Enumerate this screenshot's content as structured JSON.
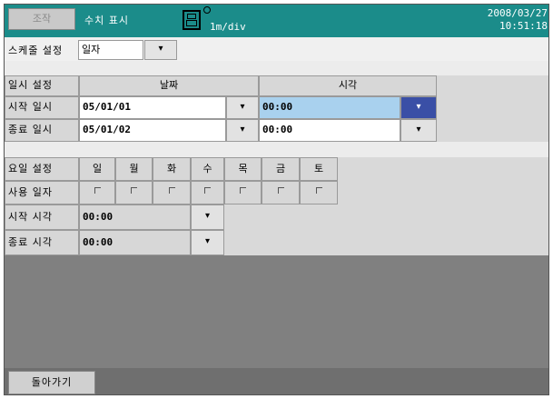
{
  "topbar": {
    "operation_label": "조작",
    "title": "수치 표시",
    "time_div": "1m/div",
    "date": "2008/03/27",
    "time": "10:51:18"
  },
  "schedule": {
    "label": "스케줄 설정",
    "value": "일자",
    "dropdown_glyph": "▾"
  },
  "datetime_table": {
    "header_label": "일시 설정",
    "col_date": "날짜",
    "col_time": "시각",
    "rows": [
      {
        "label": "시작 일시",
        "date": "05/01/01",
        "time": "00:00"
      },
      {
        "label": "종료 일시",
        "date": "05/01/02",
        "time": "00:00"
      }
    ]
  },
  "weekday_table": {
    "header_label": "요일 설정",
    "days": [
      "일",
      "월",
      "화",
      "수",
      "목",
      "금",
      "토"
    ],
    "use_label": "사용 일자",
    "use_checked": [
      false,
      false,
      false,
      false,
      false,
      false,
      false
    ],
    "start_label": "시작 시각",
    "start_time": "00:00",
    "end_label": "종료 시각",
    "end_time": "00:00"
  },
  "footer": {
    "back_label": "돌아가기"
  },
  "colors": {
    "topbar": "#1b8c8a",
    "selected_field": "#a9d1ee",
    "selected_dropdown": "#3a4fa6",
    "lower_panel": "#808080"
  }
}
